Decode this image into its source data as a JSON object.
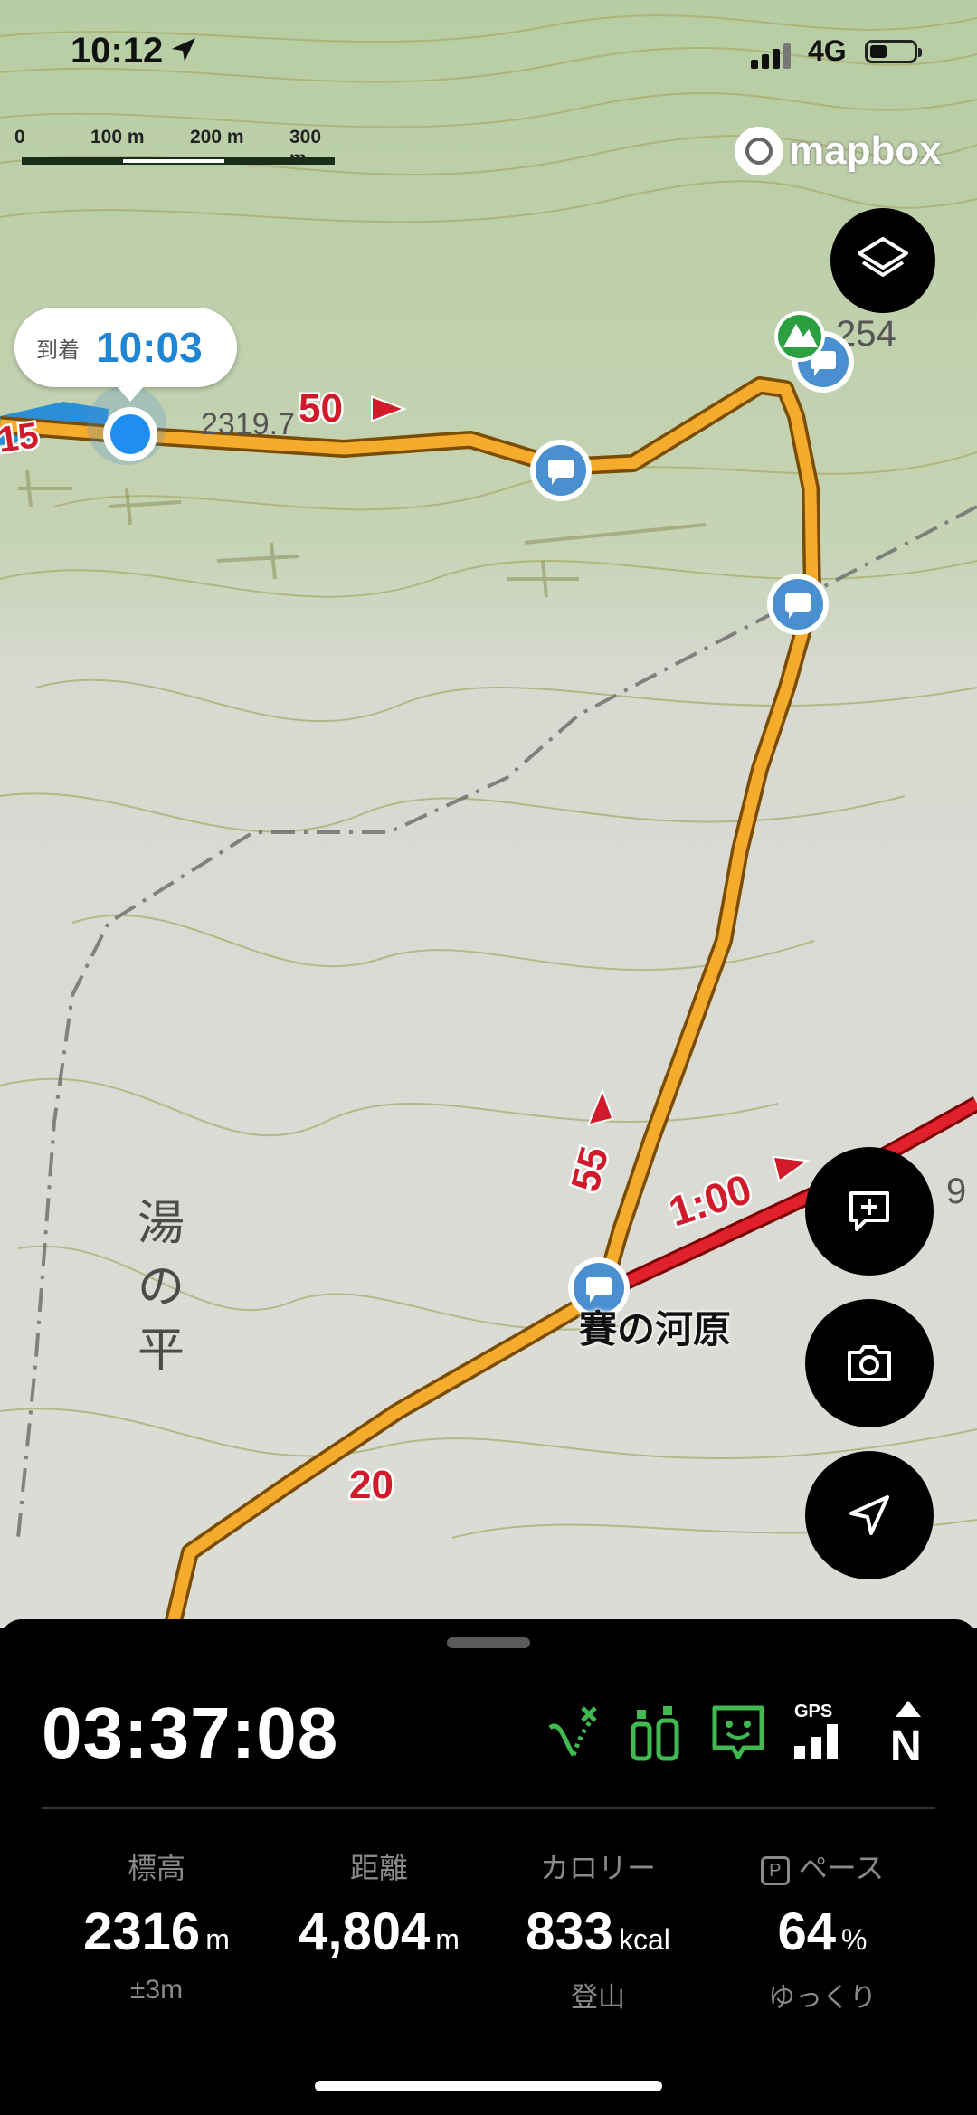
{
  "status_bar": {
    "time": "10:12",
    "network": "4G"
  },
  "map": {
    "scale_labels": [
      "0",
      "100 m",
      "200 m",
      "300 m"
    ],
    "attribution": "mapbox",
    "arrival": {
      "label": "到着",
      "time": "10:03"
    },
    "route_markers": [
      "15",
      "50",
      "55",
      "20",
      "1:00"
    ],
    "map_text": {
      "peak_code": "254",
      "contour_number": "2319.7",
      "right_edge": "9"
    },
    "place_name": "賽の河原",
    "area_name": "湯の平"
  },
  "panel": {
    "elapsed": "03:37:08",
    "status_icons": [
      "route-icon",
      "gas-cans-icon",
      "face-icon",
      "gps-icon",
      "north-icon"
    ],
    "gps_label": "GPS",
    "north_label": "N",
    "stats": [
      {
        "label": "標高",
        "value": "2316",
        "unit": "m",
        "sub": "±3m"
      },
      {
        "label": "距離",
        "value": "4,804",
        "unit": "m",
        "sub": ""
      },
      {
        "label": "カロリー",
        "value": "833",
        "unit": "kcal",
        "sub": "登山"
      },
      {
        "label": "ペース",
        "value": "64",
        "unit": "%",
        "sub": "ゆっくり"
      }
    ]
  },
  "colors": {
    "route_orange": "#f5ab2b",
    "route_red": "#e0202a",
    "marker_blue": "#4a90d0",
    "panel_green": "#3fb950"
  }
}
